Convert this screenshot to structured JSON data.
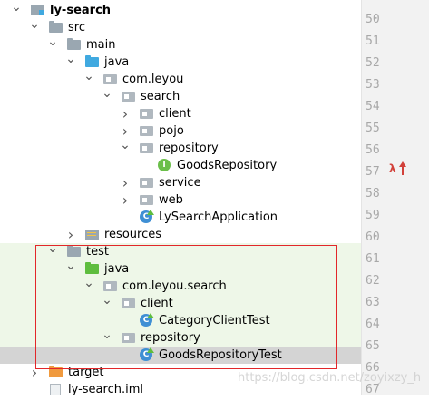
{
  "tree": {
    "rows": [
      {
        "label": "ly-search",
        "icon": "module-folder-icon",
        "arrow": "expanded",
        "level": 0
      },
      {
        "label": "src",
        "icon": "folder-icon",
        "arrow": "expanded",
        "level": 1
      },
      {
        "label": "main",
        "icon": "folder-icon",
        "arrow": "expanded",
        "level": 2
      },
      {
        "label": "java",
        "icon": "source-folder-icon",
        "arrow": "expanded",
        "level": 3
      },
      {
        "label": "com.leyou",
        "icon": "package-icon",
        "arrow": "expanded",
        "level": 4
      },
      {
        "label": "search",
        "icon": "package-icon",
        "arrow": "expanded",
        "level": 5
      },
      {
        "label": "client",
        "icon": "package-icon",
        "arrow": "collapsed",
        "level": 6
      },
      {
        "label": "pojo",
        "icon": "package-icon",
        "arrow": "collapsed",
        "level": 6
      },
      {
        "label": "repository",
        "icon": "package-icon",
        "arrow": "expanded",
        "level": 6
      },
      {
        "label": "GoodsRepository",
        "icon": "interface-icon",
        "arrow": "none",
        "level": 7
      },
      {
        "label": "service",
        "icon": "package-icon",
        "arrow": "collapsed",
        "level": 6
      },
      {
        "label": "web",
        "icon": "package-icon",
        "arrow": "collapsed",
        "level": 6
      },
      {
        "label": "LySearchApplication",
        "icon": "spring-boot-class-icon",
        "arrow": "none",
        "level": 6
      },
      {
        "label": "resources",
        "icon": "resources-folder-icon",
        "arrow": "collapsed",
        "level": 3
      },
      {
        "label": "test",
        "icon": "folder-icon",
        "arrow": "expanded",
        "level": 2
      },
      {
        "label": "java",
        "icon": "test-source-folder-icon",
        "arrow": "expanded",
        "level": 3
      },
      {
        "label": "com.leyou.search",
        "icon": "package-icon",
        "arrow": "expanded",
        "level": 4
      },
      {
        "label": "client",
        "icon": "package-icon",
        "arrow": "expanded",
        "level": 5
      },
      {
        "label": "CategoryClientTest",
        "icon": "test-class-icon",
        "arrow": "none",
        "level": 6
      },
      {
        "label": "repository",
        "icon": "package-icon",
        "arrow": "expanded",
        "level": 5
      },
      {
        "label": "GoodsRepositoryTest",
        "icon": "test-class-icon",
        "arrow": "none",
        "level": 6,
        "selected": true
      },
      {
        "label": "target",
        "icon": "excluded-folder-icon",
        "arrow": "collapsed",
        "level": 1
      },
      {
        "label": "ly-search.iml",
        "icon": "iml-file-icon",
        "arrow": "none",
        "level": 1
      }
    ]
  },
  "gutter": {
    "line_numbers": [
      "50",
      "51",
      "52",
      "53",
      "54",
      "55",
      "56",
      "57",
      "58",
      "59",
      "60",
      "61",
      "62",
      "63",
      "64",
      "65",
      "66",
      "67"
    ],
    "marker_line": "57",
    "marker_icon": "lambda-override-icon"
  },
  "watermark": "https://blog.csdn.net/zoyixzy_h",
  "colors": {
    "test_background": "#eef7e8",
    "selection": "#d4d4d4",
    "annotation_box": "#e2272a"
  }
}
